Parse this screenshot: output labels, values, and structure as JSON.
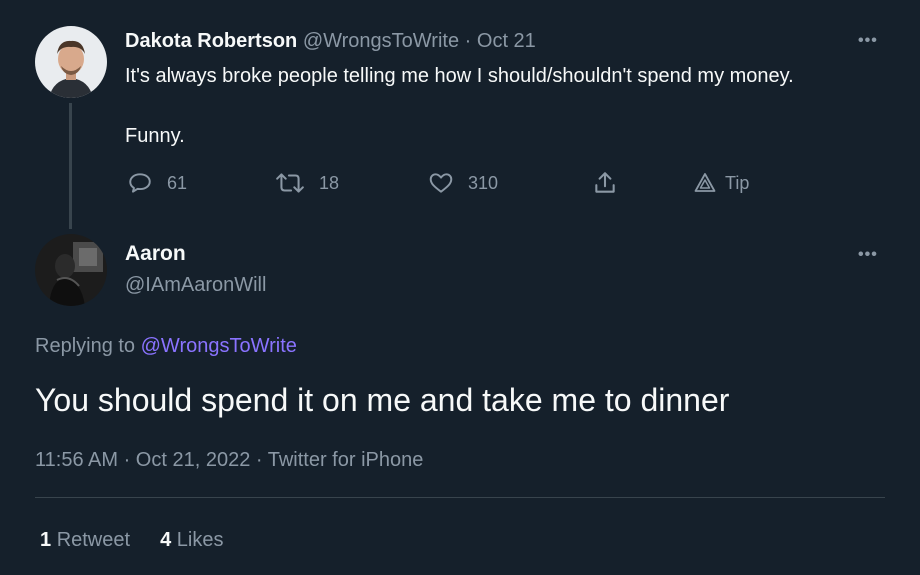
{
  "colors": {
    "background": "#15202b",
    "muted_text": "#8b98a5",
    "link": "#8a73ff",
    "divider": "#38444d"
  },
  "parent_tweet": {
    "name": "Dakota Robertson",
    "handle": "@WrongsToWrite",
    "separator": "·",
    "date": "Oct 21",
    "text_line1": "It's always broke people telling me how I should/shouldn't spend my money.",
    "text_line2": "Funny.",
    "more_label": "•••",
    "actions": {
      "reply_count": "61",
      "retweet_count": "18",
      "like_count": "310",
      "tip_label": "Tip"
    },
    "icons": [
      "reply-icon",
      "retweet-icon",
      "like-icon",
      "share-icon",
      "tip-icon"
    ]
  },
  "reply_tweet": {
    "name": "Aaron",
    "handle": "@IAmAaronWill",
    "more_label": "•••",
    "replying_prefix": "Replying to",
    "replying_to": "@WrongsToWrite",
    "text": "You should spend it on me and take me to dinner",
    "timestamp": "11:56 AM · Oct 21, 2022 · Twitter for iPhone",
    "retweets_count": "1",
    "retweets_label": "Retweet",
    "likes_count": "4",
    "likes_label": "Likes"
  }
}
